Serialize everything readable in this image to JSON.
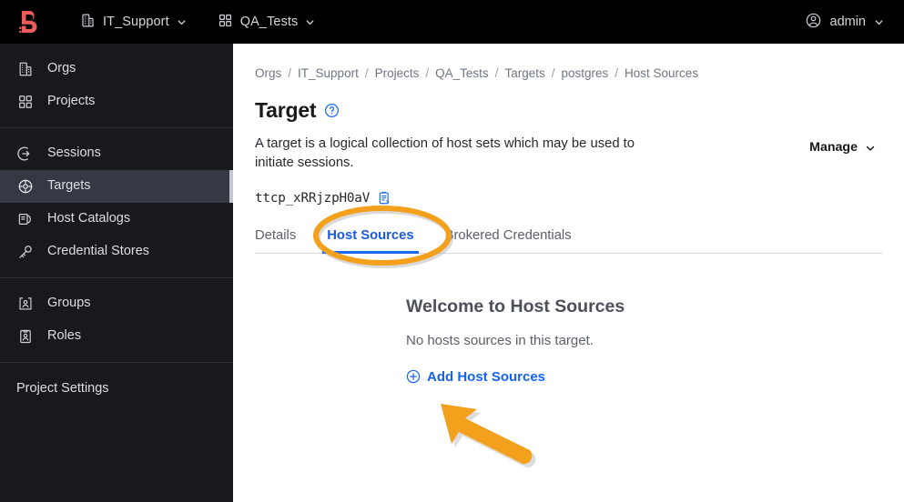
{
  "header": {
    "logo_name": "boundary-logo",
    "logo_color": "#eb5c5c",
    "org_nav": {
      "label": "IT_Support",
      "icon": "building-icon"
    },
    "project_nav": {
      "label": "QA_Tests",
      "icon": "grid-icon"
    },
    "user": {
      "label": "admin",
      "icon": "user-circle-icon"
    },
    "background": "#000000"
  },
  "sidebar": {
    "background": "#17191e",
    "active_background": "#343943",
    "groups": [
      {
        "items": [
          {
            "label": "Orgs",
            "icon": "building-icon"
          },
          {
            "label": "Projects",
            "icon": "grid-icon"
          }
        ]
      },
      {
        "items": [
          {
            "label": "Sessions",
            "icon": "session-arrow-icon"
          },
          {
            "label": "Targets",
            "icon": "target-crosshair-icon",
            "active": true
          },
          {
            "label": "Host Catalogs",
            "icon": "host-catalog-icon"
          },
          {
            "label": "Credential Stores",
            "icon": "key-icon"
          }
        ]
      },
      {
        "items": [
          {
            "label": "Groups",
            "icon": "groups-icon"
          },
          {
            "label": "Roles",
            "icon": "roles-badge-icon"
          }
        ]
      }
    ],
    "footer_item": {
      "label": "Project Settings"
    }
  },
  "breadcrumb": [
    "Orgs",
    "IT_Support",
    "Projects",
    "QA_Tests",
    "Targets",
    "postgres",
    "Host Sources"
  ],
  "breadcrumb_separator": "/",
  "page": {
    "title": "Target",
    "help_icon": "question-circle-icon",
    "description": "A target is a logical collection of host sets which may be used to initiate sessions.",
    "manage_label": "Manage",
    "manage_icon": "chevron-down-icon",
    "resource_id": "ttcp_xRRjzpH0aV",
    "copy_icon": "copy-clipboard-icon"
  },
  "tabs": [
    {
      "label": "Details",
      "active": false
    },
    {
      "label": "Host Sources",
      "active": true
    },
    {
      "label": "Brokered Credentials",
      "active": false
    }
  ],
  "empty_state": {
    "title": "Welcome to Host Sources",
    "subtitle": "No hosts sources in this target.",
    "action_label": "Add Host Sources",
    "action_icon": "plus-circle-icon"
  },
  "annotations": {
    "color": "#f3a01c",
    "ellipse": {
      "name": "highlight-ellipse",
      "target": "Host Sources tab"
    },
    "arrow": {
      "name": "pointer-arrow",
      "target": "Add Host Sources link"
    }
  },
  "colors": {
    "accent_blue": "#1563f5",
    "tab_active": "#1868f2",
    "annotation_orange": "#f3a01c",
    "logo_red": "#eb5c5c"
  }
}
